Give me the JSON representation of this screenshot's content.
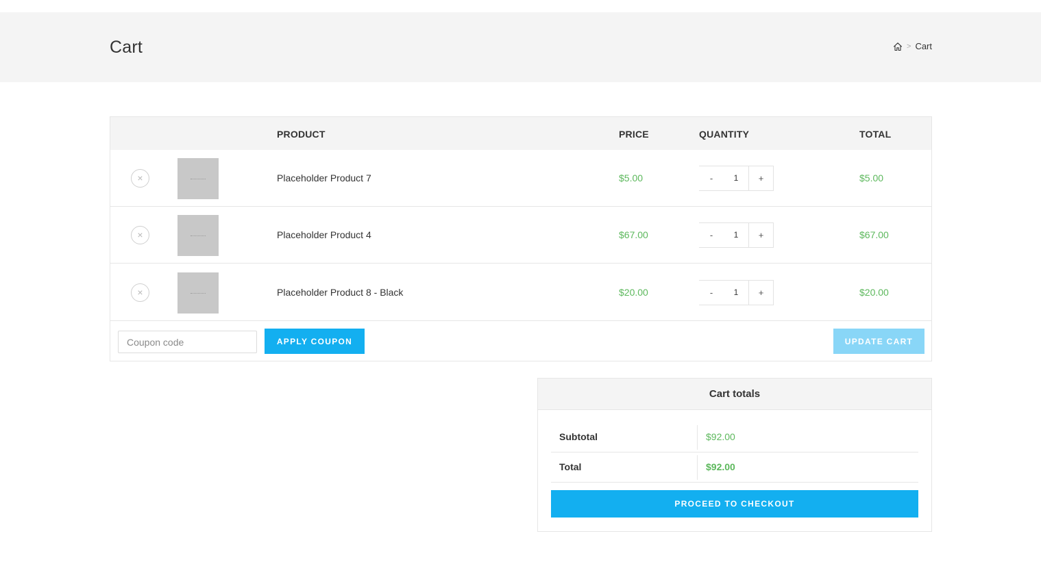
{
  "header": {
    "title": "Cart",
    "breadcrumb": {
      "home_icon": "home-icon",
      "separator": ">",
      "current": "Cart"
    }
  },
  "cart": {
    "columns": {
      "product": "Product",
      "price": "Price",
      "quantity": "Quantity",
      "total": "Total"
    },
    "items": [
      {
        "remove": "×",
        "name": "Placeholder Product 7",
        "price": "$5.00",
        "quantity": "1",
        "total": "$5.00"
      },
      {
        "remove": "×",
        "name": "Placeholder Product 4",
        "price": "$67.00",
        "quantity": "1",
        "total": "$67.00"
      },
      {
        "remove": "×",
        "name": "Placeholder Product 8 - Black",
        "price": "$20.00",
        "quantity": "1",
        "total": "$20.00"
      }
    ],
    "qty_minus": "-",
    "qty_plus": "+",
    "coupon_placeholder": "Coupon code",
    "apply_coupon": "Apply coupon",
    "update_cart": "Update cart"
  },
  "totals": {
    "title": "Cart totals",
    "subtotal_label": "Subtotal",
    "subtotal_value": "$92.00",
    "total_label": "Total",
    "total_value": "$92.00",
    "checkout": "Proceed to checkout"
  },
  "colors": {
    "accent": "#13aff0",
    "accent_disabled": "#89d6f7",
    "price": "#5cb85c",
    "band": "#f4f4f4"
  }
}
